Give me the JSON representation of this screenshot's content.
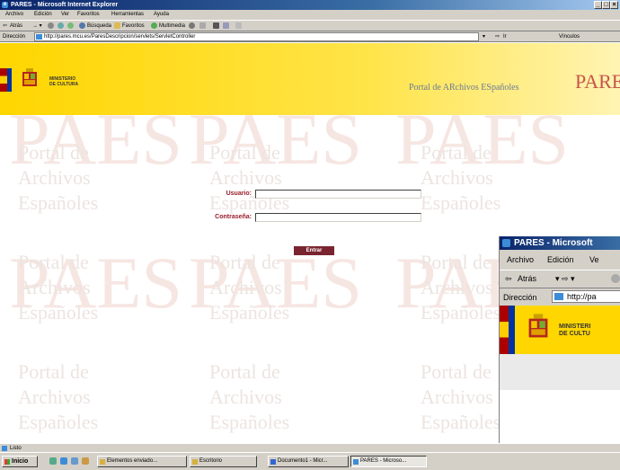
{
  "window": {
    "title": "PARES - Microsoft Internet Explorer",
    "controls": [
      "_",
      "□",
      "×"
    ]
  },
  "menubar": [
    "Archivo",
    "Edición",
    "Ver",
    "Favoritos",
    "Herramientas",
    "Ayuda"
  ],
  "toolbar": {
    "back": "Atrás",
    "search": "Búsqueda",
    "favorites": "Favoritos",
    "multimedia": "Multimedia"
  },
  "addressbar": {
    "label": "Dirección",
    "url": "http://pares.mcu.es/ParesDescripcion/servlets/ServletController",
    "go": "Ir",
    "links": "Vínculos"
  },
  "header": {
    "ministry_line1": "MINISTERIO",
    "ministry_line2": "DE CULTURA",
    "portal": "Portal de ARchivos ESpañoles",
    "logo": "PARES"
  },
  "watermark": {
    "text": "Portal de\nArchivos\nEspañoles",
    "big": "PAES"
  },
  "login": {
    "user_label": "Usuario:",
    "user_value": "",
    "pass_label": "Contraseña:",
    "pass_value": "",
    "submit": "Entrar"
  },
  "status": {
    "text": "Listo"
  },
  "taskbar": {
    "start": "Inicio",
    "tasks": [
      "Elementos enviado...",
      "Escritorio",
      "Documento1 - Micr...",
      "PARES - Microso..."
    ]
  },
  "second_window": {
    "title": "PARES - Microsoft",
    "menu": [
      "Archivo",
      "Edición",
      "Ve"
    ],
    "back": "Atrás",
    "addr_label": "Dirección",
    "url": "http://pa",
    "ministry_line1": "MINISTERI",
    "ministry_line2": "DE CULTU"
  }
}
